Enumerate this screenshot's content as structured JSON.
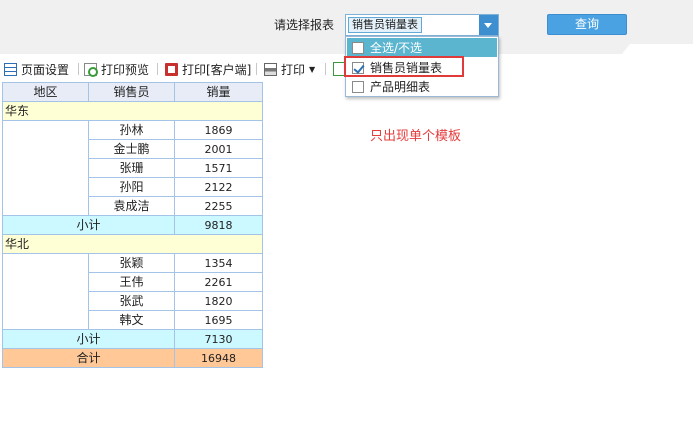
{
  "params": {
    "label": "请选择报表",
    "selected_tag": "销售员销量表",
    "query_button": "查询"
  },
  "dropdown": {
    "items": [
      {
        "label": "全选/不选",
        "checked": false,
        "active": true
      },
      {
        "label": "销售员销量表",
        "checked": true,
        "active": false
      },
      {
        "label": "产品明细表",
        "checked": false,
        "active": false
      }
    ]
  },
  "toolbar": {
    "page_setup": "页面设置",
    "print_preview": "打印预览",
    "print_client": "打印[客户端]",
    "print": "打印"
  },
  "report": {
    "headers": [
      "地区",
      "销售员",
      "销量"
    ],
    "groups": [
      {
        "region": "华东",
        "rows": [
          {
            "name": "孙林",
            "qty": "1869"
          },
          {
            "name": "金士鹏",
            "qty": "2001"
          },
          {
            "name": "张珊",
            "qty": "1571"
          },
          {
            "name": "孙阳",
            "qty": "2122"
          },
          {
            "name": "袁成洁",
            "qty": "2255"
          }
        ],
        "subtotal_label": "小计",
        "subtotal": "9818"
      },
      {
        "region": "华北",
        "rows": [
          {
            "name": "张颖",
            "qty": "1354"
          },
          {
            "name": "王伟",
            "qty": "2261"
          },
          {
            "name": "张武",
            "qty": "1820"
          },
          {
            "name": "韩文",
            "qty": "1695"
          }
        ],
        "subtotal_label": "小计",
        "subtotal": "7130"
      }
    ],
    "total_label": "合计",
    "total": "16948"
  },
  "annotation": "只出现单个模板",
  "colors": {
    "accent": "#4aa2e2",
    "highlight": "#e03a3a",
    "region_bg": "#ffffd6",
    "subtotal_bg": "#ccf8ff",
    "total_bg": "#ffc896"
  }
}
